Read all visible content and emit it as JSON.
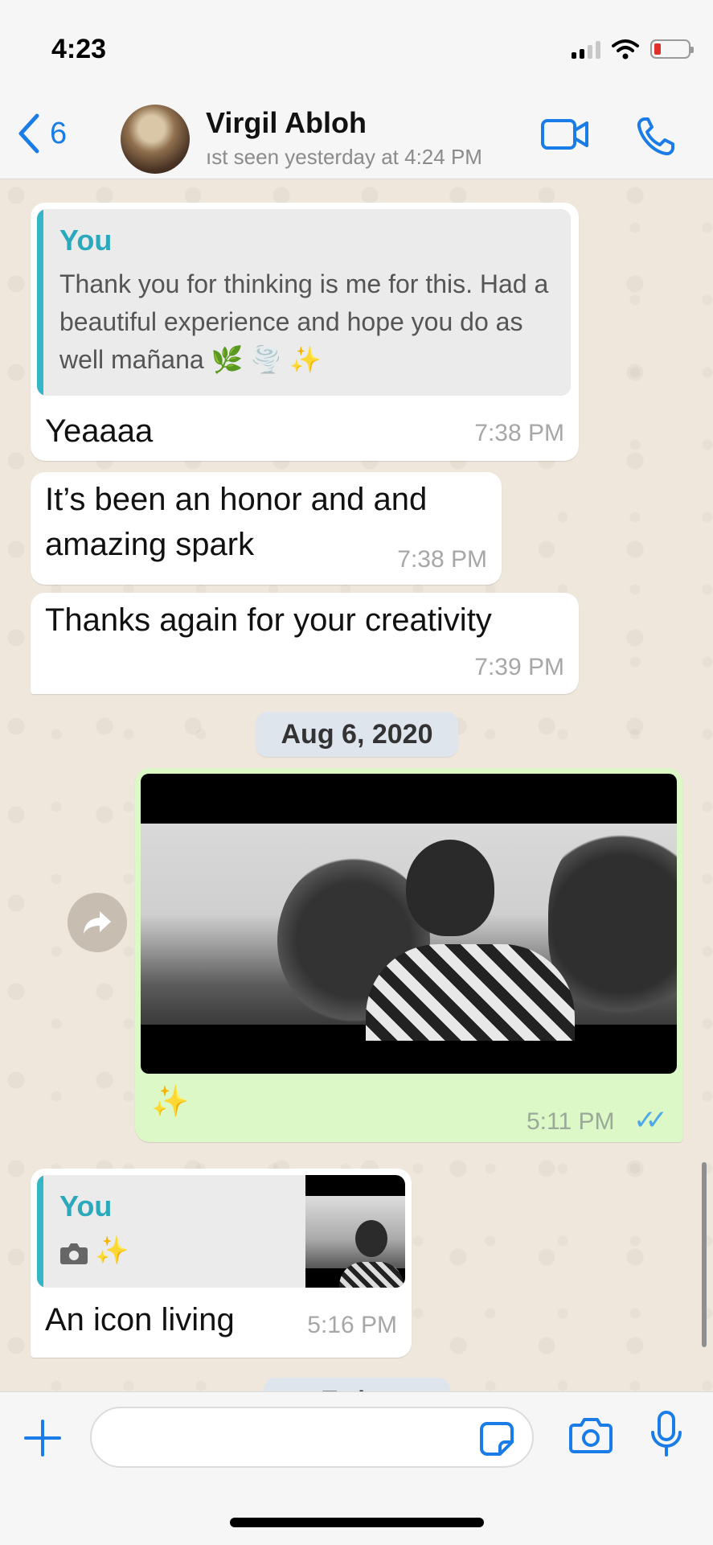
{
  "status_bar": {
    "time": "4:23"
  },
  "header": {
    "back_count": "6",
    "contact_name": "Virgil Abloh",
    "contact_status": "ıst seen yesterday at 4:24 PM"
  },
  "messages": {
    "m1": {
      "quote_author": "You",
      "quote_text": "Thank you for thinking is me for this. Had a beautiful experience and hope you do as well mañana 🌿 🌪️ ✨",
      "text": "Yeaaaa",
      "time": "7:38 PM"
    },
    "m2": {
      "text": "It’s been an honor and and amazing spark",
      "time": "7:38 PM"
    },
    "m3": {
      "text": "Thanks again for your creativity",
      "time": "7:39 PM"
    },
    "date_chip": "Aug 6, 2020",
    "m4": {
      "caption": "✨",
      "time": "5:11 PM",
      "ticks": "✓✓"
    },
    "m5": {
      "quote_author": "You",
      "quote_caption": "✨",
      "text": "An icon living",
      "time": "5:16 PM"
    },
    "next_date_chip": "Today"
  },
  "colors": {
    "accent": "#1a7ce6",
    "outgoing_bubble": "#dcf8c6",
    "quote_bar": "#35b6c7"
  },
  "icons": [
    "back-chevron-icon",
    "video-call-icon",
    "phone-icon",
    "forward-icon",
    "camera-icon",
    "plus-icon",
    "sticker-icon",
    "microphone-icon"
  ]
}
